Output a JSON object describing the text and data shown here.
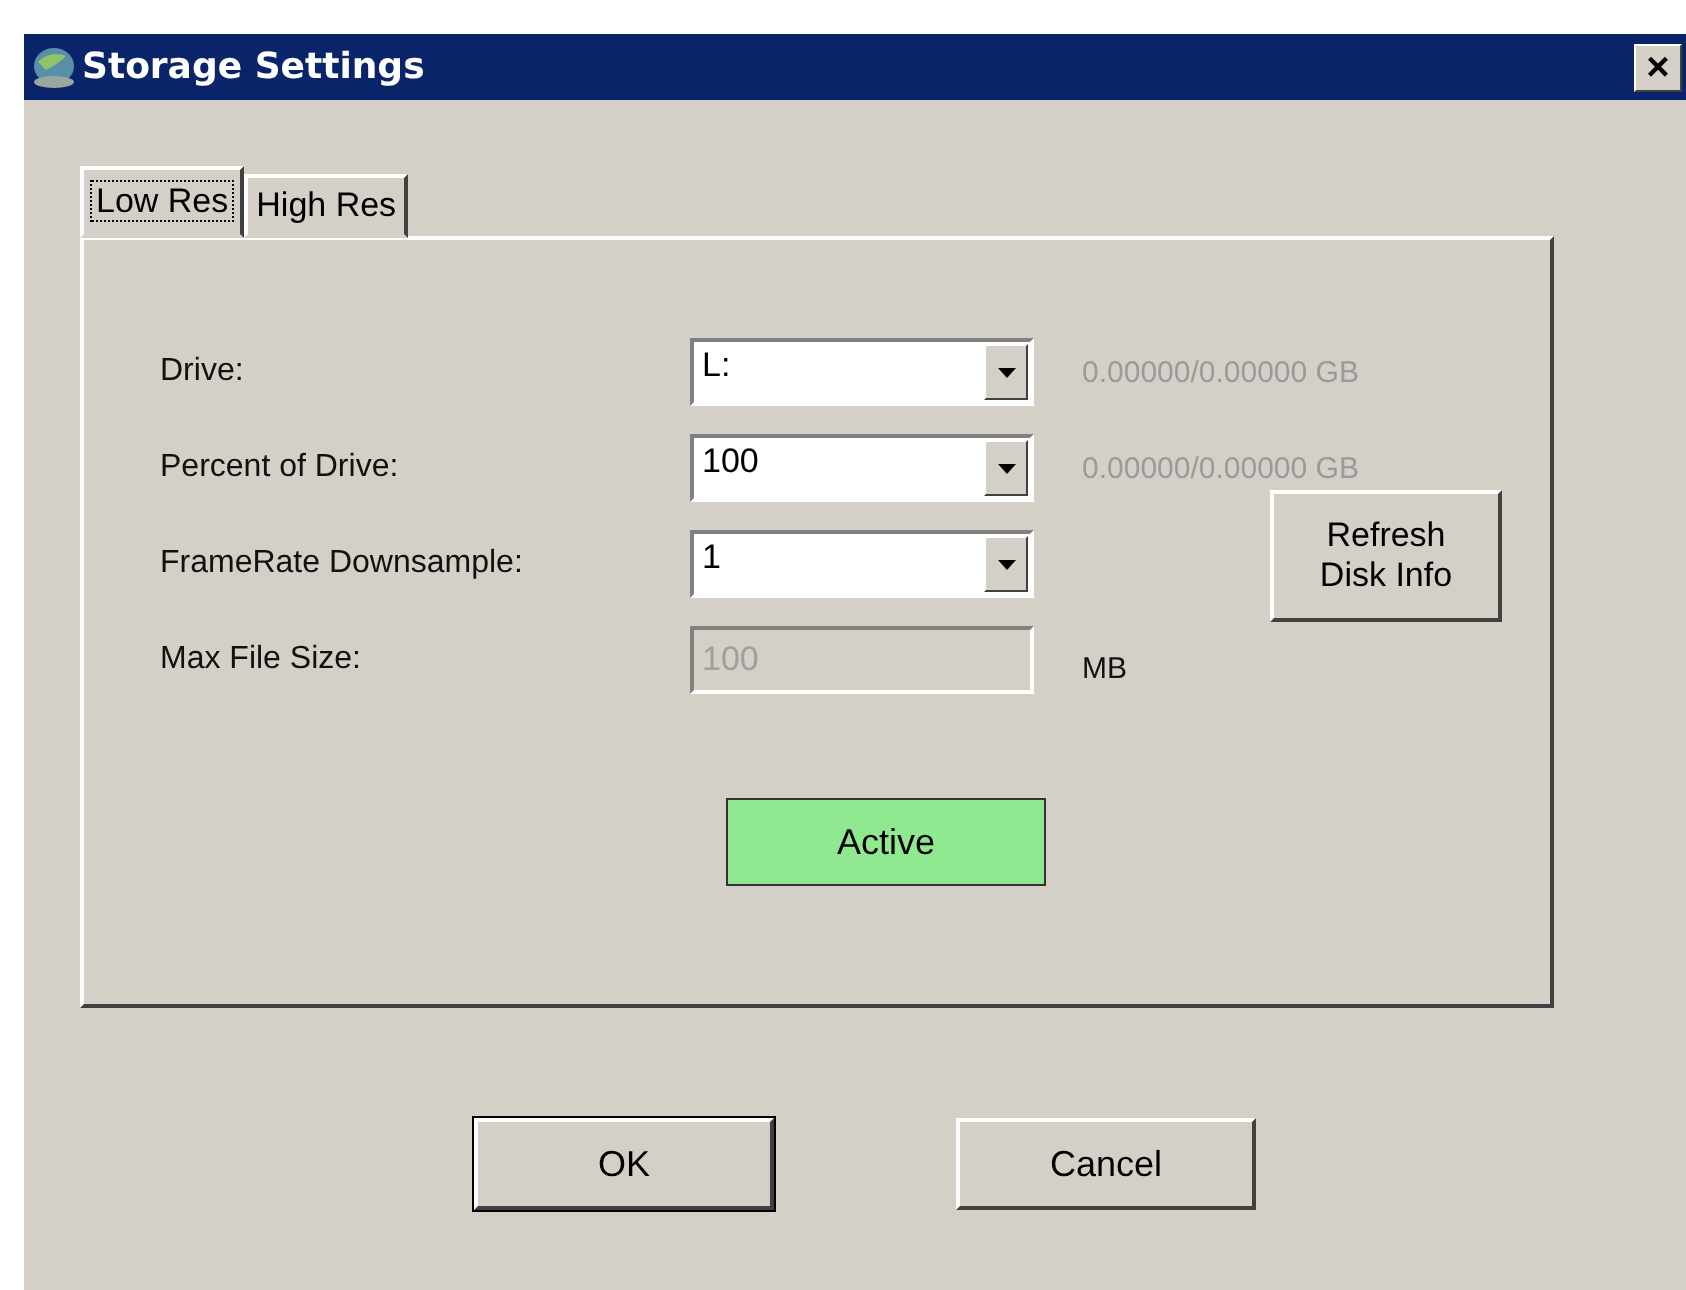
{
  "window": {
    "title": "Storage Settings",
    "close": "×"
  },
  "tabs": [
    {
      "label": "Low Res",
      "selected": true
    },
    {
      "label": "High Res",
      "selected": false
    }
  ],
  "fields": [
    {
      "label": "Drive:",
      "kind": "combo",
      "value": "L:",
      "info": "0.00000/0.00000 GB"
    },
    {
      "label": "Percent of Drive:",
      "kind": "combo",
      "value": "100",
      "info": "0.00000/0.00000 GB"
    },
    {
      "label": "FrameRate Downsample:",
      "kind": "combo",
      "value": "1"
    },
    {
      "label": "Max File Size:",
      "kind": "text",
      "value": "100",
      "disabled": true,
      "info": "MB"
    }
  ],
  "refresh_button": "Refresh Disk Info",
  "status_button": {
    "label": "Active",
    "active": true
  },
  "buttons": [
    {
      "label": "OK",
      "default": true
    },
    {
      "label": "Cancel",
      "default": false
    }
  ]
}
